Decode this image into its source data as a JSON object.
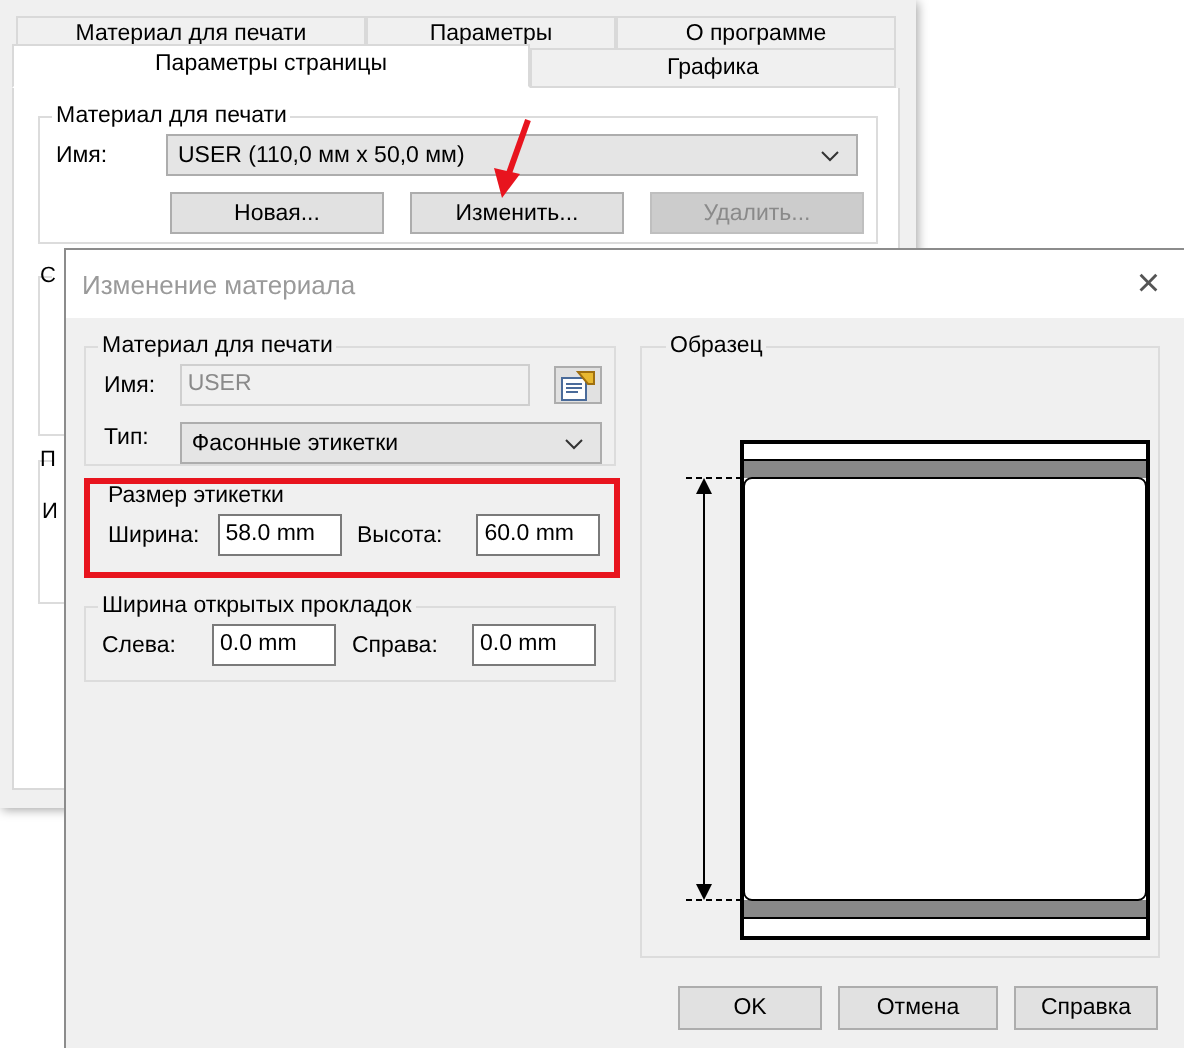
{
  "back_window": {
    "tab_rows": [
      [
        {
          "label": "Материал для печати",
          "selected": false
        },
        {
          "label": "Параметры",
          "selected": false
        },
        {
          "label": "О программе",
          "selected": false
        }
      ],
      [
        {
          "label": "Параметры страницы",
          "selected": true
        },
        {
          "label": "Графика",
          "selected": false
        }
      ]
    ],
    "media_group": {
      "title": "Материал для печати",
      "name_label": "Имя:",
      "name_value": "USER (110,0 мм x 50,0 мм)",
      "buttons": [
        {
          "label": "Новая...",
          "disabled": false
        },
        {
          "label": "Изменить...",
          "disabled": false
        },
        {
          "label": "Удалить...",
          "disabled": true
        }
      ]
    },
    "hidden_groups": [
      {
        "title": "С"
      },
      {
        "title": "П",
        "text": "И"
      }
    ]
  },
  "dialog": {
    "title": "Изменение материала",
    "close": "×",
    "media": {
      "title": "Материал для печати",
      "name_label": "Имя:",
      "name_value": "USER",
      "name_disabled": true,
      "type_label": "Тип:",
      "type_value": "Фасонные этикетки"
    },
    "size": {
      "title": "Размер этикетки",
      "fields": [
        {
          "label": "Ширина:",
          "value": "58.0 mm"
        },
        {
          "label": "Высота:",
          "value": "60.0 mm"
        }
      ]
    },
    "liner": {
      "title": "Ширина открытых прокладок",
      "fields": [
        {
          "label": "Слева:",
          "value": "0.0 mm"
        },
        {
          "label": "Справа:",
          "value": "0.0 mm"
        }
      ]
    },
    "preview": {
      "title": "Образец"
    },
    "buttons": [
      "OK",
      "Отмена",
      "Справка"
    ]
  }
}
